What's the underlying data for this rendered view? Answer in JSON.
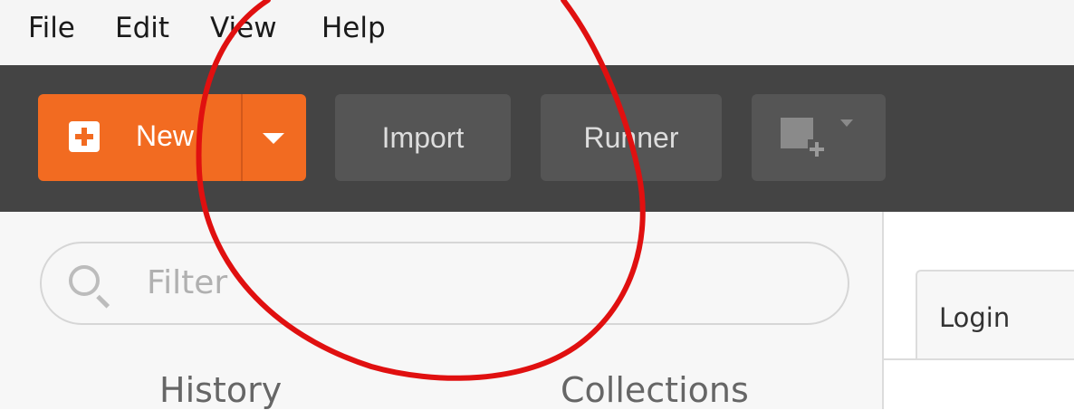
{
  "menu": {
    "items": [
      {
        "label": "File"
      },
      {
        "label": "Edit"
      },
      {
        "label": "View"
      },
      {
        "label": "Help"
      }
    ]
  },
  "toolbar": {
    "new_label": "New",
    "import_label": "Import",
    "runner_label": "Runner",
    "new_icon": "plus-square-icon",
    "new_dropdown_icon": "caret-down-icon",
    "workspace_icon": "new-window-icon"
  },
  "sidebar": {
    "filter_placeholder": "Filter",
    "search_icon": "search-icon",
    "tabs": [
      {
        "label": "History"
      },
      {
        "label": "Collections"
      }
    ]
  },
  "main": {
    "tabs": [
      {
        "label": "Login"
      }
    ]
  },
  "colors": {
    "accent_orange": "#f26b21",
    "toolbar_bg": "#444444",
    "button_dark": "#555555",
    "annotation_red": "#e01010"
  }
}
